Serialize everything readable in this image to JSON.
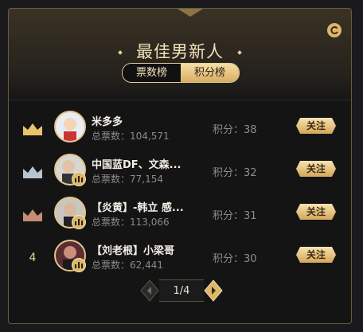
{
  "header": {
    "title": "最佳男新人"
  },
  "tabs": [
    {
      "label": "票数榜",
      "active": true
    },
    {
      "label": "积分榜",
      "active": false
    }
  ],
  "rows": [
    {
      "rank_icon": "gold-crown-icon",
      "name": "米多多",
      "votes": "总票数：104,571",
      "score": "积分：38",
      "follow_label": "关注",
      "avatar_color": "#e9edf3"
    },
    {
      "rank_icon": "silver-crown-icon",
      "name": "中国蓝DF、文森...",
      "votes": "总票数：77,154",
      "score": "积分：32",
      "follow_label": "关注",
      "avatar_color": "#d8d6d2"
    },
    {
      "rank_icon": "bronze-crown-icon",
      "name": "【炎黄】-韩立 感...",
      "votes": "总票数：113,066",
      "score": "积分：31",
      "follow_label": "关注",
      "avatar_color": "#c9c6c1"
    },
    {
      "rank": "4",
      "name": "【刘老根】小梁哥",
      "votes": "总票数：62,441",
      "score": "积分：30",
      "follow_label": "关注",
      "avatar_color": "#5b2d32"
    }
  ],
  "pager": {
    "text": "1/4"
  },
  "colors": {
    "gold": "#e8cf95",
    "crown_gold": "#e8c46a",
    "crown_silver": "#b8c4d2",
    "crown_bronze": "#c48d74"
  }
}
